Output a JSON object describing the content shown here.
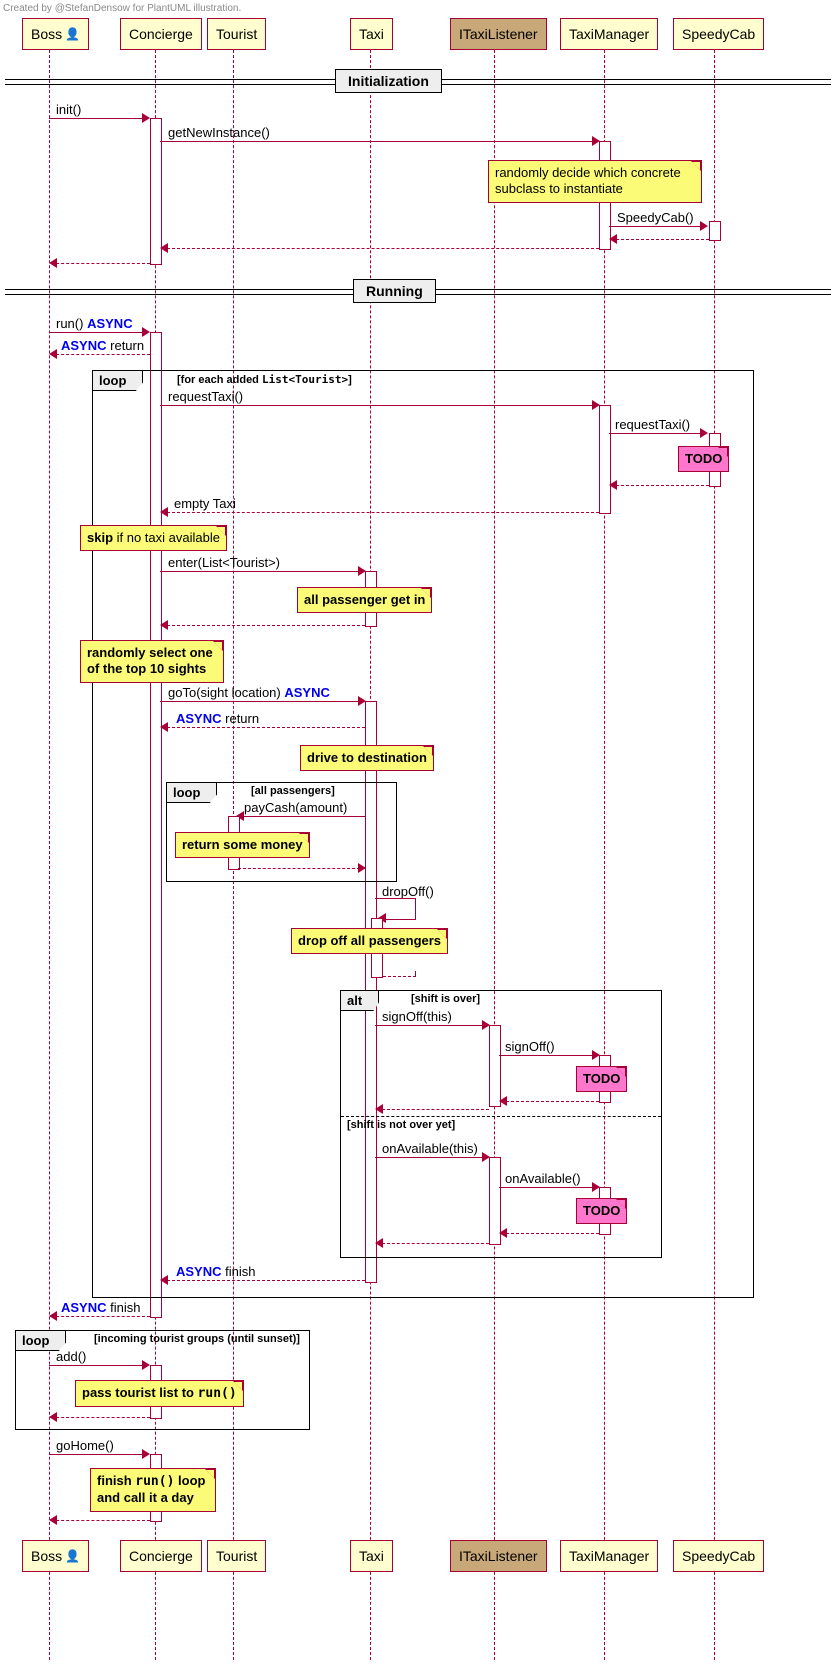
{
  "credit": "Created by @StefanDensow for PlantUML illustration.",
  "participants": {
    "boss": "Boss",
    "concierge": "Concierge",
    "tourist": "Tourist",
    "taxi": "Taxi",
    "ilistener": "ITaxiListener",
    "manager": "TaxiManager",
    "speedy": "SpeedyCab"
  },
  "dividers": {
    "init": "Initialization",
    "running": "Running"
  },
  "messages": {
    "m_init": "init()",
    "m_getnew": "getNewInstance()",
    "m_speedy": "SpeedyCab()",
    "m_run": "run()",
    "m_async_ret": "return",
    "m_reqtaxi": "requestTaxi()",
    "m_reqtaxi2": "requestTaxi()",
    "m_emptytaxi": "empty Taxi",
    "m_enter": "enter(List<Tourist>)",
    "m_goto": "goTo(sight location)",
    "m_paycash": "payCash(amount)",
    "m_dropoff": "dropOff()",
    "m_signoff": "signOff(this)",
    "m_signoff2": "signOff()",
    "m_onavail": "onAvailable(this)",
    "m_onavail2": "onAvailable()",
    "m_async_finish": "finish",
    "m_add": "add()",
    "m_gohome": "goHome()"
  },
  "async_kw": "ASYNC",
  "notes": {
    "n_random_subclass": "randomly decide which concrete subclass to instantiate",
    "n_todo": "TODO",
    "n_skip": "skip if no taxi available",
    "n_allgetin": "all passenger get in",
    "n_top10": "randomly select one of the top 10 sights",
    "n_drive": "drive to destination",
    "n_retmoney": "return some money",
    "n_dropall": "drop off all passengers",
    "n_passlist_a": "pass tourist list to ",
    "n_passlist_b": "run()",
    "n_finish_a": "finish ",
    "n_finish_b": "run()",
    "n_finish_c": " loop and call it a day"
  },
  "frames": {
    "loop": "loop",
    "alt": "alt",
    "cond_foreach": "[for each added List<Tourist>]",
    "cond_allpass": "[all passengers]",
    "cond_shiftover": "[shift is over]",
    "cond_shiftnotover": "[shift is not over yet]",
    "cond_incoming": "[incoming tourist groups (until sunset)]"
  }
}
